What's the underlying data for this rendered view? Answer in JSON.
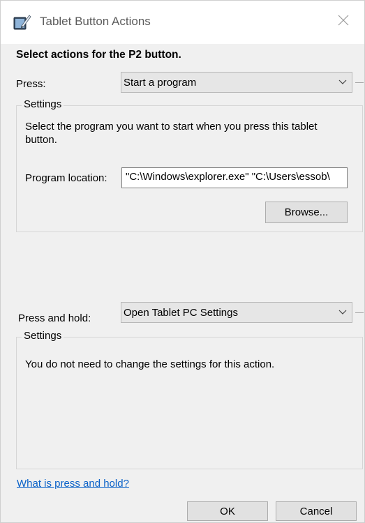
{
  "window": {
    "title": "Tablet Button Actions",
    "title_icon": "tablet-pen-icon",
    "close_icon": "close-icon"
  },
  "heading": "Select actions for the P2 button.",
  "press": {
    "label": "Press:",
    "selected": "Start a program",
    "settings_legend": "Settings",
    "description": "Select the program you want to start when you press this tablet button.",
    "program_location_label": "Program location:",
    "program_location_value": "\"C:\\Windows\\explorer.exe\" \"C:\\Users\\essob\\",
    "browse_label": "Browse..."
  },
  "press_and_hold": {
    "label": "Press and hold:",
    "selected": "Open Tablet PC Settings",
    "settings_legend": "Settings",
    "description": "You do not need to change the settings for this action."
  },
  "help_link": "What is press and hold?",
  "buttons": {
    "ok": "OK",
    "cancel": "Cancel"
  },
  "colors": {
    "link": "#0b62c8",
    "window_bg": "#f0f0f0",
    "titlebar_bg": "#ffffff"
  }
}
